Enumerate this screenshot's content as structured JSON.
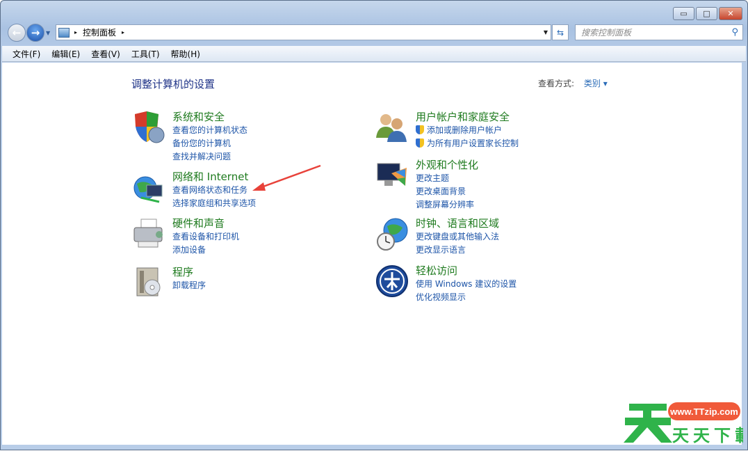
{
  "window": {
    "minimize": "▭",
    "maximize": "□",
    "close": "✕"
  },
  "address": {
    "crumb": "控制面板",
    "sep": "▸"
  },
  "search": {
    "placeholder": "搜索控制面板"
  },
  "menu": [
    "文件(F)",
    "编辑(E)",
    "查看(V)",
    "工具(T)",
    "帮助(H)"
  ],
  "main": {
    "heading": "调整计算机的设置",
    "view_by_label": "查看方式:",
    "view_by_value": "类别",
    "categories": [
      {
        "title": "系统和安全",
        "links": [
          "查看您的计算机状态",
          "备份您的计算机",
          "查找并解决问题"
        ]
      },
      {
        "title": "网络和 Internet",
        "links": [
          "查看网络状态和任务",
          "选择家庭组和共享选项"
        ]
      },
      {
        "title": "硬件和声音",
        "links": [
          "查看设备和打印机",
          "添加设备"
        ]
      },
      {
        "title": "程序",
        "links": [
          "卸载程序"
        ]
      },
      {
        "title": "用户帐户和家庭安全",
        "links": [
          "添加或删除用户帐户",
          "为所有用户设置家长控制"
        ]
      },
      {
        "title": "外观和个性化",
        "links": [
          "更改主题",
          "更改桌面背景",
          "调整屏幕分辨率"
        ]
      },
      {
        "title": "时钟、语言和区域",
        "links": [
          "更改键盘或其他输入法",
          "更改显示语言"
        ]
      },
      {
        "title": "轻松访问",
        "links": [
          "使用 Windows 建议的设置",
          "优化视频显示"
        ]
      }
    ]
  },
  "watermark": {
    "url": "www.TTzip.com",
    "text": "天天下载",
    "big": "天"
  },
  "colors": {
    "link": "#1e55a8",
    "title": "#1e7a1e",
    "arrow": "#e8423a",
    "logo_green": "#2fb34a",
    "logo_orange": "#f05a3a"
  }
}
